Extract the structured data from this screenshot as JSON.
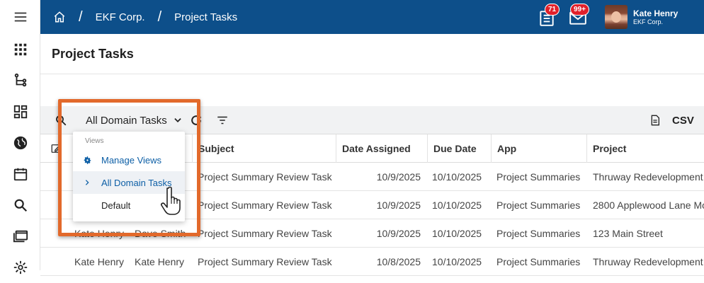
{
  "breadcrumb": {
    "org": "EKF Corp.",
    "page": "Project Tasks"
  },
  "notifications": {
    "tasks_count": "71",
    "messages_count": "99+"
  },
  "user": {
    "name": "Kate Henry",
    "org": "EKF Corp."
  },
  "page": {
    "title": "Project Tasks"
  },
  "toolbar": {
    "view_label": "All Domain Tasks",
    "csv_label": "CSV"
  },
  "dropdown": {
    "header": "Views",
    "items": [
      {
        "label": "Manage Views"
      },
      {
        "label": "All Domain Tasks"
      },
      {
        "label": "Default"
      }
    ]
  },
  "table": {
    "columns": [
      "Subject",
      "Date Assigned",
      "Due Date",
      "App",
      "Project"
    ],
    "rows": [
      {
        "assignee": "",
        "assigner": "",
        "subject": "Project Summary Review Task",
        "assigned": "10/9/2025",
        "due": "10/10/2025",
        "app": "Project Summaries",
        "project": "Thruway Redevelopment"
      },
      {
        "assignee": "",
        "assigner": "",
        "subject": "Project Summary Review Task",
        "assigned": "10/9/2025",
        "due": "10/10/2025",
        "app": "Project Summaries",
        "project": "2800 Applewood Lane Mo"
      },
      {
        "assignee": "Kate Henry",
        "assigner": "Dave Smith",
        "subject": "Project Summary Review Task",
        "assigned": "10/9/2025",
        "due": "10/10/2025",
        "app": "Project Summaries",
        "project": "123 Main Street"
      },
      {
        "assignee": "Kate Henry",
        "assigner": "Kate Henry",
        "subject": "Project Summary Review Task",
        "assigned": "10/8/2025",
        "due": "10/10/2025",
        "app": "Project Summaries",
        "project": "Thruway Redevelopment"
      }
    ]
  },
  "colors": {
    "topbar": "#0d4f8a",
    "highlight": "#e2692b",
    "badge": "#e0202a"
  }
}
